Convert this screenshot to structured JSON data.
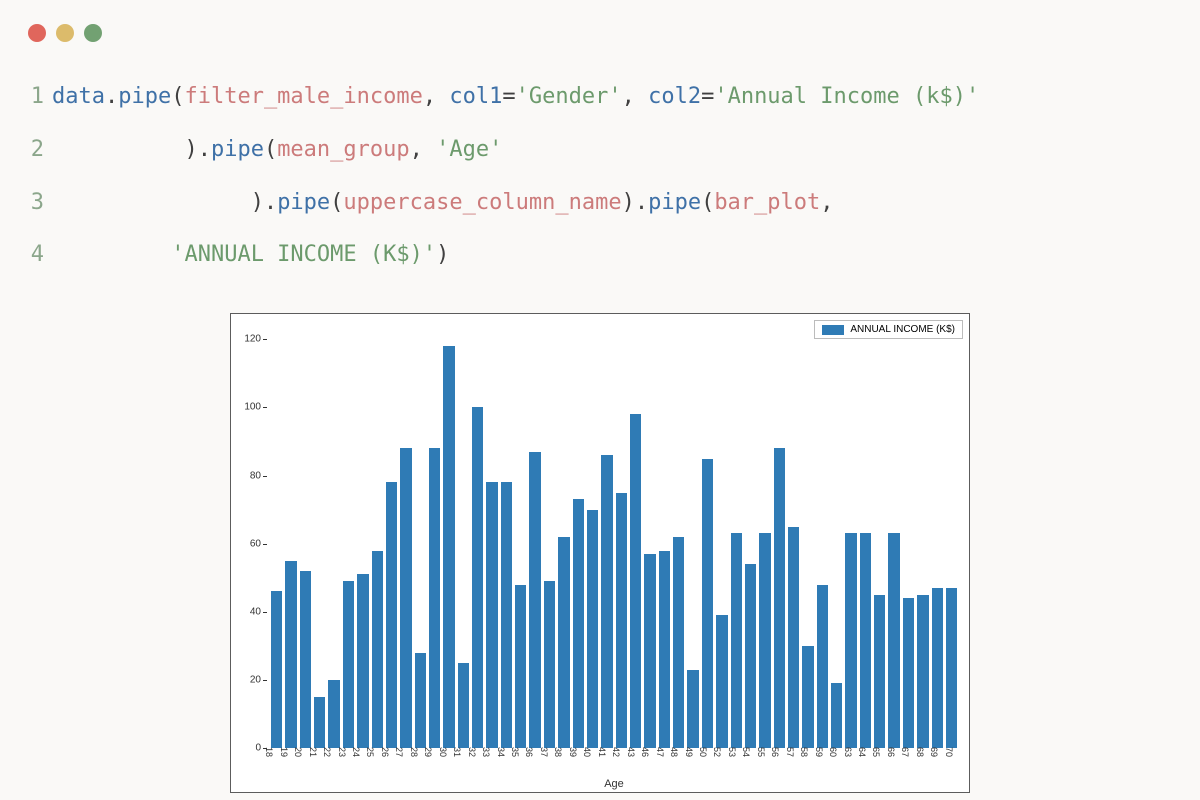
{
  "window": {
    "traffic_colors": {
      "red": "#e0665c",
      "yellow": "#dcbb6b",
      "green": "#72a172"
    }
  },
  "code": {
    "lines": [
      {
        "n": "1",
        "tokens": [
          {
            "t": "data",
            "c": "tok-ident"
          },
          {
            "t": ".",
            "c": "tok-punct"
          },
          {
            "t": "pipe",
            "c": "tok-ident"
          },
          {
            "t": "(",
            "c": "tok-punct"
          },
          {
            "t": "filter_male_income",
            "c": "tok-call"
          },
          {
            "t": ", ",
            "c": "tok-punct"
          },
          {
            "t": "col1",
            "c": "tok-kw"
          },
          {
            "t": "=",
            "c": "tok-punct"
          },
          {
            "t": "'Gender'",
            "c": "tok-string"
          },
          {
            "t": ", ",
            "c": "tok-punct"
          },
          {
            "t": "col2",
            "c": "tok-kw"
          },
          {
            "t": "=",
            "c": "tok-punct"
          },
          {
            "t": "'Annual Income (k$)'",
            "c": "tok-string"
          }
        ]
      },
      {
        "n": "2",
        "tokens": [
          {
            "t": "          ",
            "c": "tok-punct"
          },
          {
            "t": ").",
            "c": "tok-punct"
          },
          {
            "t": "pipe",
            "c": "tok-ident"
          },
          {
            "t": "(",
            "c": "tok-punct"
          },
          {
            "t": "mean_group",
            "c": "tok-call"
          },
          {
            "t": ", ",
            "c": "tok-punct"
          },
          {
            "t": "'Age'",
            "c": "tok-string"
          }
        ]
      },
      {
        "n": "3",
        "tokens": [
          {
            "t": "               ",
            "c": "tok-punct"
          },
          {
            "t": ").",
            "c": "tok-punct"
          },
          {
            "t": "pipe",
            "c": "tok-ident"
          },
          {
            "t": "(",
            "c": "tok-punct"
          },
          {
            "t": "uppercase_column_name",
            "c": "tok-call"
          },
          {
            "t": ").",
            "c": "tok-punct"
          },
          {
            "t": "pipe",
            "c": "tok-ident"
          },
          {
            "t": "(",
            "c": "tok-punct"
          },
          {
            "t": "bar_plot",
            "c": "tok-call"
          },
          {
            "t": ",",
            "c": "tok-punct"
          }
        ]
      },
      {
        "n": "4",
        "tokens": [
          {
            "t": "         ",
            "c": "tok-punct"
          },
          {
            "t": "'ANNUAL INCOME (K$)'",
            "c": "tok-string"
          },
          {
            "t": ")",
            "c": "tok-punct"
          }
        ]
      }
    ]
  },
  "chart_data": {
    "type": "bar",
    "title": "",
    "xlabel": "Age",
    "ylabel": "",
    "legend_label": "ANNUAL INCOME (K$)",
    "legend_position": "upper right",
    "ylim": [
      0,
      125
    ],
    "yticks": [
      0,
      20,
      40,
      60,
      80,
      100,
      120
    ],
    "categories": [
      18,
      19,
      20,
      21,
      22,
      23,
      24,
      25,
      26,
      27,
      28,
      29,
      30,
      31,
      32,
      33,
      34,
      35,
      36,
      37,
      38,
      39,
      40,
      41,
      42,
      43,
      46,
      47,
      48,
      49,
      50,
      52,
      53,
      54,
      55,
      56,
      57,
      58,
      59,
      60,
      63,
      64,
      65,
      66,
      67,
      68,
      69,
      70
    ],
    "values": [
      46,
      55,
      52,
      15,
      20,
      49,
      51,
      58,
      78,
      88,
      28,
      88,
      118,
      25,
      100,
      78,
      78,
      48,
      87,
      49,
      62,
      73,
      70,
      86,
      75,
      98,
      57,
      58,
      62,
      23,
      85,
      39,
      63,
      54,
      63,
      88,
      65,
      30,
      48,
      19,
      63,
      63,
      45,
      63,
      44,
      45,
      47,
      47
    ],
    "bar_color": "#2f7bb5",
    "grid": false
  }
}
